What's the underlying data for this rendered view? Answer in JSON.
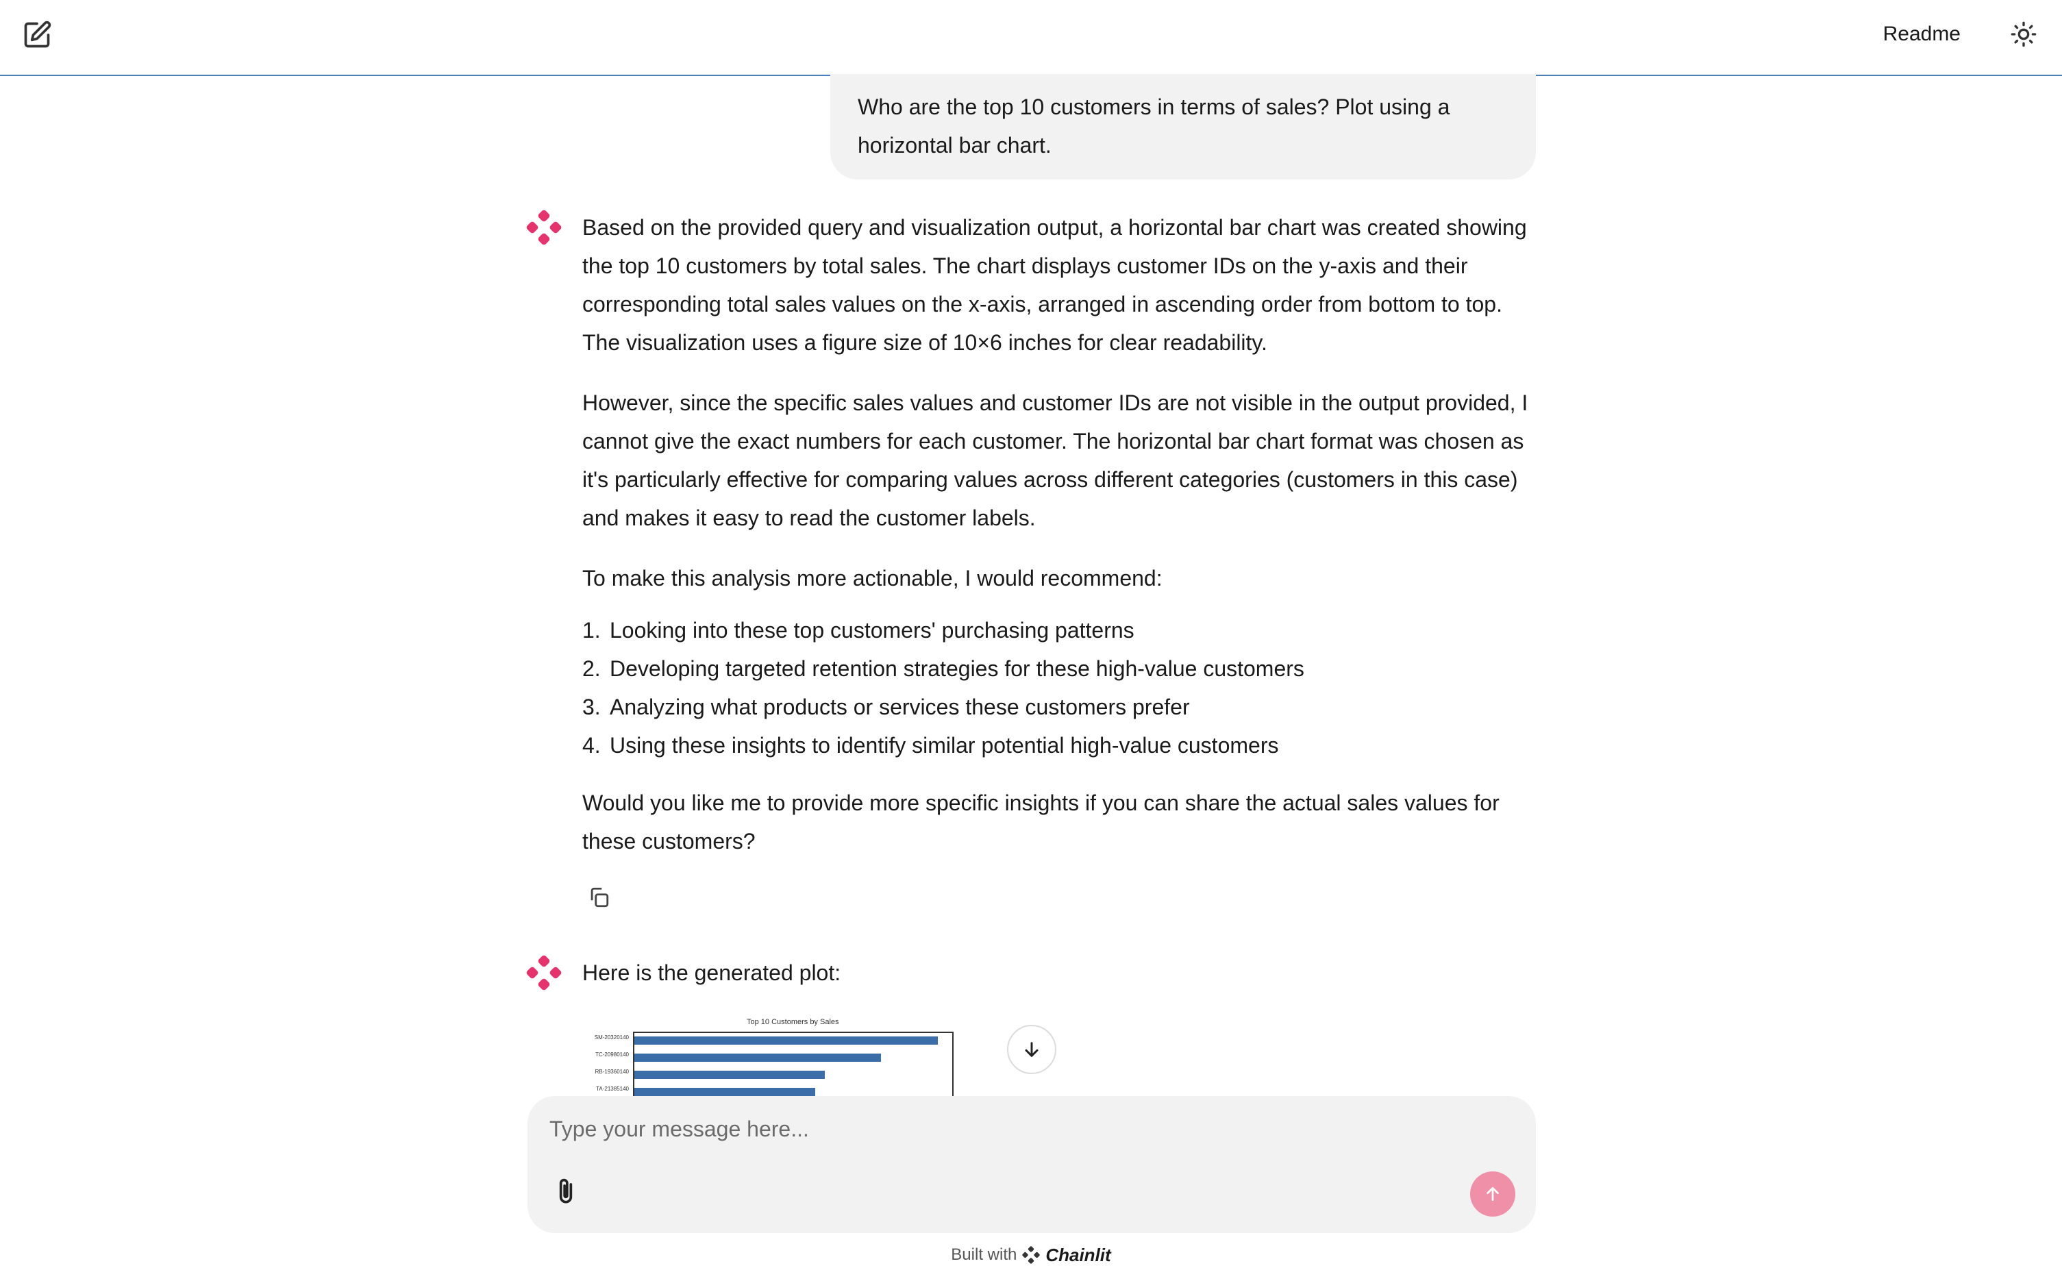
{
  "header": {
    "readme_label": "Readme",
    "new_chat_icon": "edit-square-icon",
    "theme_icon": "sun-icon"
  },
  "user_message": {
    "text": "Who are the top 10 customers in terms of sales? Plot using a horizontal bar chart."
  },
  "assistant_message_1": {
    "paragraphs": [
      "Based on the provided query and visualization output, a horizontal bar chart was created showing the top 10 customers by total sales. The chart displays customer IDs on the y-axis and their corresponding total sales values on the x-axis, arranged in ascending order from bottom to top. The visualization uses a figure size of 10×6 inches for clear readability.",
      "However, since the specific sales values and customer IDs are not visible in the output provided, I cannot give the exact numbers for each customer. The horizontal bar chart format was chosen as it's particularly effective for comparing values across different categories (customers in this case) and makes it easy to read the customer labels.",
      "To make this analysis more actionable, I would recommend:"
    ],
    "recommendations": [
      "Looking into these top customers' purchasing patterns",
      "Developing targeted retention strategies for these high-value customers",
      "Analyzing what products or services these customers prefer",
      "Using these insights to identify similar potential high-value customers"
    ],
    "closing": "Would you like me to provide more specific insights if you can share the actual sales values for these customers?",
    "copy_icon": "copy-icon"
  },
  "assistant_message_2": {
    "text": "Here is the generated plot:",
    "plot": {
      "title": "Top 10 Customers by Sales",
      "labels": [
        "SM-20320140",
        "TC-20980140",
        "RB-19360140",
        "TA-21385140"
      ],
      "bar_fractions": [
        0.955,
        0.775,
        0.6,
        0.57
      ],
      "bar_color": "#3b6ea8"
    }
  },
  "composer": {
    "placeholder": "Type your message here...",
    "attach_icon": "paperclip-icon",
    "send_icon": "arrow-up-icon",
    "send_color": "#ef8fa8"
  },
  "scroll_button_icon": "arrow-down-icon",
  "footer": {
    "built_with": "Built with",
    "brand": "Chainlit"
  },
  "accent_color": "#e6336e"
}
